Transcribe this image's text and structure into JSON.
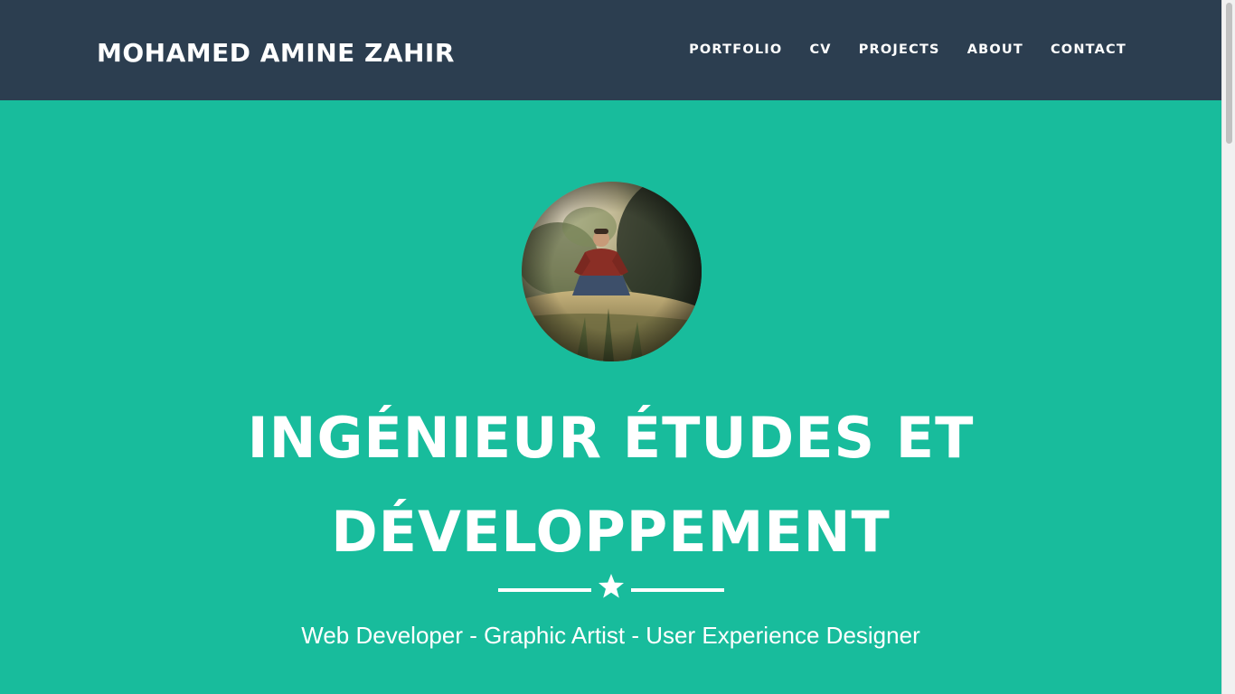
{
  "navbar": {
    "brand": "MOHAMED AMINE ZAHIR",
    "items": [
      "PORTFOLIO",
      "CV",
      "PROJECTS",
      "ABOUT",
      "CONTACT"
    ]
  },
  "hero": {
    "avatar_alt": "profile-photo",
    "headline_line1": "INGÉNIEUR ÉTUDES ET",
    "headline_line2": "DÉVELOPPEMENT",
    "divider_icon": "star-icon",
    "tagline": "Web Developer - Graphic Artist - User Experience Designer"
  },
  "colors": {
    "navbar_bg": "#2c3e50",
    "hero_bg": "#18bc9c",
    "text": "#ffffff"
  }
}
